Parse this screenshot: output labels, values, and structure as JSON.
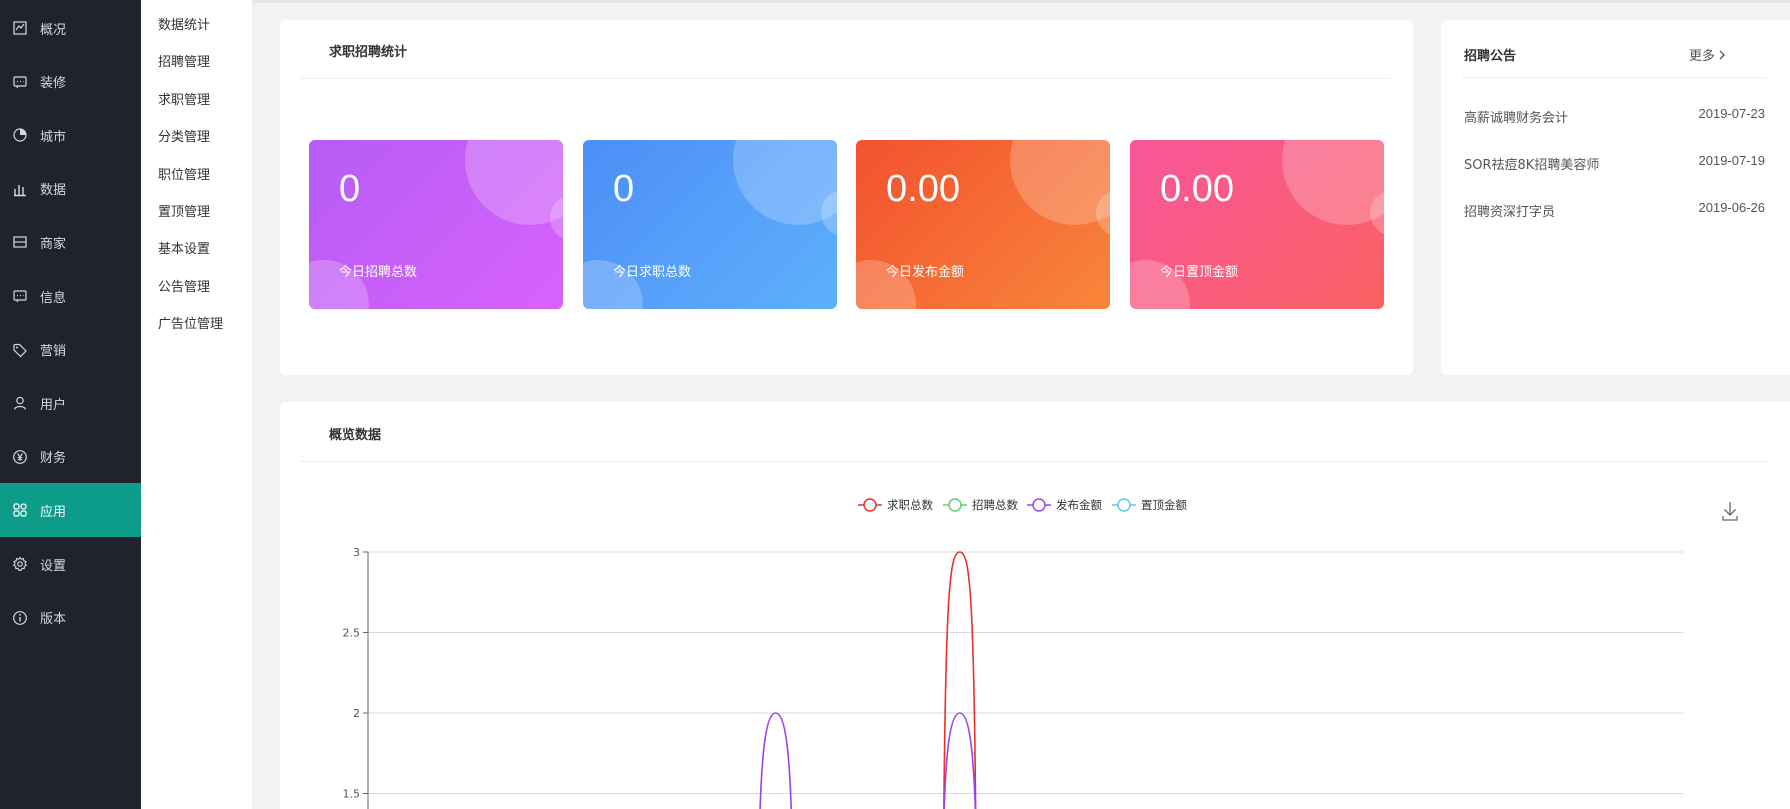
{
  "sidebar": {
    "items": [
      {
        "label": "概况",
        "icon": "overview-icon"
      },
      {
        "label": "装修",
        "icon": "decoration-icon"
      },
      {
        "label": "城市",
        "icon": "city-icon"
      },
      {
        "label": "数据",
        "icon": "bar-chart-icon"
      },
      {
        "label": "商家",
        "icon": "store-icon"
      },
      {
        "label": "信息",
        "icon": "message-icon"
      },
      {
        "label": "营销",
        "icon": "tag-icon"
      },
      {
        "label": "用户",
        "icon": "user-icon"
      },
      {
        "label": "财务",
        "icon": "yuan-icon"
      },
      {
        "label": "应用",
        "icon": "apps-icon",
        "active": true
      },
      {
        "label": "设置",
        "icon": "gear-icon"
      },
      {
        "label": "版本",
        "icon": "info-icon"
      }
    ]
  },
  "submenu": {
    "items": [
      "数据统计",
      "招聘管理",
      "求职管理",
      "分类管理",
      "职位管理",
      "置顶管理",
      "基本设置",
      "公告管理",
      "广告位管理"
    ]
  },
  "stats": {
    "title": "求职招聘统计",
    "tiles": [
      {
        "value": "0",
        "label": "今日招聘总数"
      },
      {
        "value": "0",
        "label": "今日求职总数"
      },
      {
        "value": "0.00",
        "label": "今日发布金额"
      },
      {
        "value": "0.00",
        "label": "今日置顶金额"
      }
    ]
  },
  "notice": {
    "title": "招聘公告",
    "more": "更多",
    "items": [
      {
        "title": "高薪诚聘财务会计",
        "date": "2019-07-23"
      },
      {
        "title": "SOR祛痘8K招聘美容师",
        "date": "2019-07-19"
      },
      {
        "title": "招聘资深打字员",
        "date": "2019-06-26"
      }
    ]
  },
  "overview": {
    "title": "概览数据"
  },
  "colors": {
    "sidebar_bg": "#20232b",
    "active": "#0d9b8a",
    "series": [
      "#e8302e",
      "#5fcf67",
      "#9a45e8",
      "#56c8e8"
    ]
  },
  "chart_data": {
    "type": "line",
    "legend": [
      "求职总数",
      "招聘总数",
      "发布金额",
      "置顶金额"
    ],
    "legend_placement": "top-center",
    "y_ticks": [
      "3",
      "2.5",
      "2",
      "1.5"
    ],
    "ylim_visible": [
      1.5,
      3
    ],
    "grid": true,
    "series": [
      {
        "name": "求职总数",
        "peaks": [
          {
            "at": 0.45,
            "value": 3
          }
        ]
      },
      {
        "name": "招聘总数",
        "peaks": []
      },
      {
        "name": "发布金额",
        "peaks": [
          {
            "at": 0.31,
            "value": 2
          },
          {
            "at": 0.45,
            "value": 2
          }
        ]
      },
      {
        "name": "置顶金额",
        "peaks": []
      }
    ]
  }
}
